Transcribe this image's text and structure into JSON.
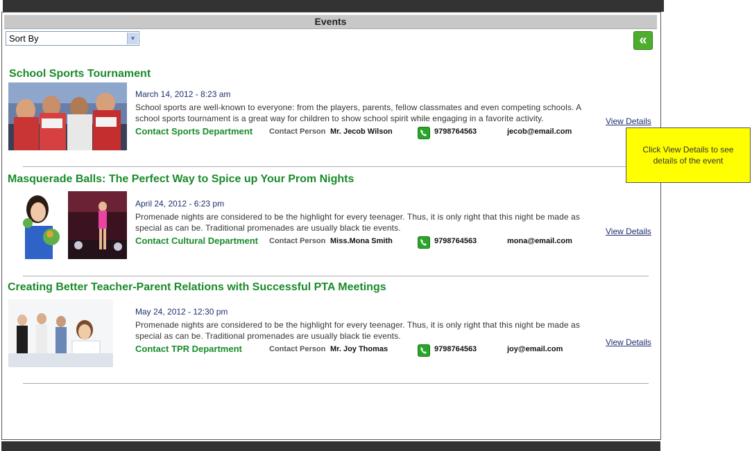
{
  "panel": {
    "title": "Events"
  },
  "sort": {
    "value": "Sort By"
  },
  "icons": {
    "back": "double-chevron-left-icon",
    "phone": "phone-icon"
  },
  "colors": {
    "accent_green": "#1a8a2a",
    "tooltip_yellow": "#ffff00",
    "header_bar": "#333333"
  },
  "tooltip": {
    "text": "Click View Details to see details of the event"
  },
  "events": [
    {
      "title": "School Sports Tournament",
      "date": "March 14, 2012 - 8:23 am",
      "description": "School sports are well-known to everyone: from the players, parents, fellow classmates and even competing schools. A school sports tournament is a great way for children to show school spirit while engaging in a favorite activity.",
      "department": "Contact Sports Department",
      "contact_label": "Contact Person",
      "contact_name": "Mr. Jecob Wilson",
      "phone": "9798764563",
      "email": "jecob@email.com",
      "view_label": "View Details"
    },
    {
      "title": "Masquerade Balls: The Perfect Way to Spice up Your Prom Nights",
      "date": "April 24, 2012 - 6:23 pm",
      "description": "Promenade nights are considered to be the highlight for every teenager. Thus, it is only right that this night be made as special as can be. Traditional promenades are usually black tie events.",
      "department": "Contact Cultural Department",
      "contact_label": "Contact Person",
      "contact_name": "Miss.Mona Smith",
      "phone": "9798764563",
      "email": "mona@email.com",
      "view_label": "View Details"
    },
    {
      "title": "Creating Better Teacher-Parent Relations with Successful PTA Meetings",
      "date": "May 24, 2012 - 12:30 pm",
      "description": "Promenade nights are considered to be the highlight for every teenager. Thus, it is only right that this night be made as special as can be. Traditional promenades are usually black tie events.",
      "department": "Contact TPR Department",
      "contact_label": "Contact Person",
      "contact_name": "Mr. Joy Thomas",
      "phone": "9798764563",
      "email": "joy@email.com",
      "view_label": "View Details"
    }
  ]
}
